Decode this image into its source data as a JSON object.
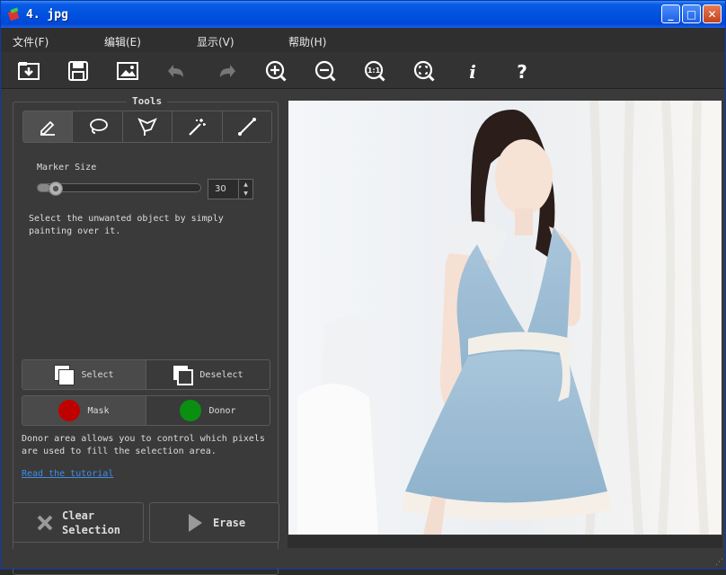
{
  "window": {
    "title": "4. jpg",
    "controls": {
      "minimize": "_",
      "maximize": "□",
      "close": "✕"
    }
  },
  "menu": [
    {
      "label": "文件(F)"
    },
    {
      "label": "编辑(E)"
    },
    {
      "label": "显示(V)"
    },
    {
      "label": "帮助(H)"
    }
  ],
  "toolbar": {
    "icons": [
      "open-icon",
      "save-icon",
      "image-icon",
      "undo-icon",
      "redo-icon",
      "zoom-in-icon",
      "zoom-out-icon",
      "actual-size-icon",
      "fit-screen-icon",
      "info-icon",
      "help-icon"
    ],
    "actual_size_label": "1:1",
    "info_label": "i",
    "help_label": "?"
  },
  "tools": {
    "legend": "Tools",
    "items": [
      "marker-tool-icon",
      "lasso-tool-icon",
      "polygon-lasso-tool-icon",
      "magic-wand-tool-icon",
      "line-tool-icon"
    ],
    "active": "marker-tool-icon",
    "marker_size_label": "Marker Size",
    "marker_size_value": "30",
    "description": "Select the unwanted object by simply painting over it."
  },
  "selection": {
    "select_label": "Select",
    "deselect_label": "Deselect"
  },
  "area": {
    "mask_label": "Mask",
    "mask_color": "#c00000",
    "donor_label": "Donor",
    "donor_color": "#0a8f10",
    "description": "Donor area allows you to control which pixels are used to fill the selection area.",
    "tutorial_link": "Read the tutorial"
  },
  "actions": {
    "clear_label_1": "Clear",
    "clear_label_2": "Selection",
    "erase_label": "Erase"
  }
}
